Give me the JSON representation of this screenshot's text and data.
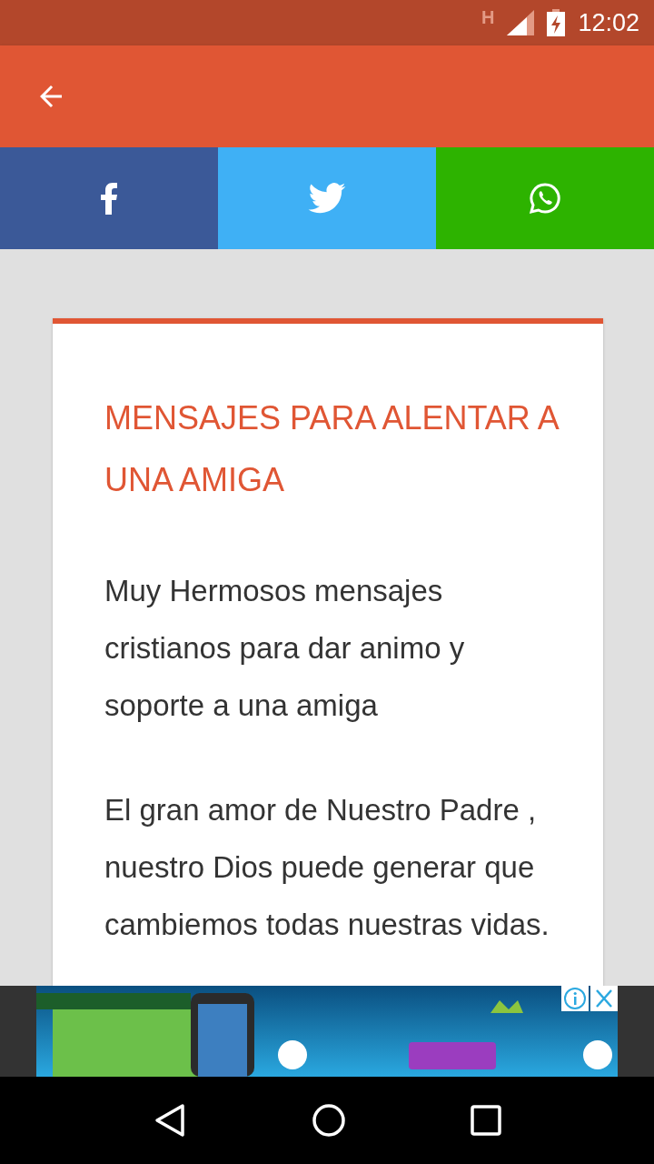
{
  "status_bar": {
    "network": "H",
    "time": "12:02"
  },
  "share_buttons": [
    {
      "kind": "facebook"
    },
    {
      "kind": "twitter"
    },
    {
      "kind": "whatsapp"
    }
  ],
  "article": {
    "title": "MENSAJES PARA ALENTAR A UNA AMIGA",
    "paragraphs": [
      "Muy Hermosos mensajes cristianos para dar animo y soporte a una amiga",
      "El gran amor de Nuestro Padre , nuestro Dios puede generar que cambiemos todas nuestras vidas."
    ]
  }
}
